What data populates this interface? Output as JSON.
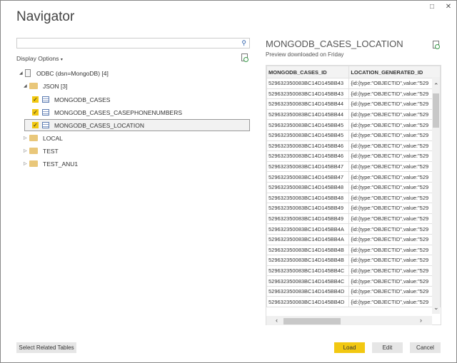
{
  "window": {
    "title": "Navigator",
    "restore_icon": "□",
    "close_icon": "✕"
  },
  "left": {
    "search_placeholder": "",
    "display_options": "Display Options",
    "dropdown_glyph": "▾",
    "tree": {
      "root": "ODBC (dsn=MongoDB) [4]",
      "json": "JSON [3]",
      "tables": [
        "MONGODB_CASES",
        "MONGODB_CASES_CASEPHONENUMBERS",
        "MONGODB_CASES_LOCATION"
      ],
      "folders": [
        "LOCAL",
        "TEST",
        "TEST_ANU1"
      ]
    }
  },
  "preview": {
    "title": "MONGODB_CASES_LOCATION",
    "subtitle": "Preview downloaded on Friday",
    "columns": [
      "MONGODB_CASES_ID",
      "LOCATION_GENERATED_ID"
    ],
    "rows": [
      [
        "529632350083BC14D145BB43",
        "{id:{type:\"OBJECTID\",value:\"529"
      ],
      [
        "529632350083BC14D145BB43",
        "{id:{type:\"OBJECTID\",value:\"529"
      ],
      [
        "529632350083BC14D145BB44",
        "{id:{type:\"OBJECTID\",value:\"529"
      ],
      [
        "529632350083BC14D145BB44",
        "{id:{type:\"OBJECTID\",value:\"529"
      ],
      [
        "529632350083BC14D145BB45",
        "{id:{type:\"OBJECTID\",value:\"529"
      ],
      [
        "529632350083BC14D145BB45",
        "{id:{type:\"OBJECTID\",value:\"529"
      ],
      [
        "529632350083BC14D145BB46",
        "{id:{type:\"OBJECTID\",value:\"529"
      ],
      [
        "529632350083BC14D145BB46",
        "{id:{type:\"OBJECTID\",value:\"529"
      ],
      [
        "529632350083BC14D145BB47",
        "{id:{type:\"OBJECTID\",value:\"529"
      ],
      [
        "529632350083BC14D145BB47",
        "{id:{type:\"OBJECTID\",value:\"529"
      ],
      [
        "529632350083BC14D145BB48",
        "{id:{type:\"OBJECTID\",value:\"529"
      ],
      [
        "529632350083BC14D145BB48",
        "{id:{type:\"OBJECTID\",value:\"529"
      ],
      [
        "529632350083BC14D145BB49",
        "{id:{type:\"OBJECTID\",value:\"529"
      ],
      [
        "529632350083BC14D145BB49",
        "{id:{type:\"OBJECTID\",value:\"529"
      ],
      [
        "529632350083BC14D145BB4A",
        "{id:{type:\"OBJECTID\",value:\"529"
      ],
      [
        "529632350083BC14D145BB4A",
        "{id:{type:\"OBJECTID\",value:\"529"
      ],
      [
        "529632350083BC14D145BB4B",
        "{id:{type:\"OBJECTID\",value:\"529"
      ],
      [
        "529632350083BC14D145BB4B",
        "{id:{type:\"OBJECTID\",value:\"529"
      ],
      [
        "529632350083BC14D145BB4C",
        "{id:{type:\"OBJECTID\",value:\"529"
      ],
      [
        "529632350083BC14D145BB4C",
        "{id:{type:\"OBJECTID\",value:\"529"
      ],
      [
        "529632350083BC14D145BB4D",
        "{id:{type:\"OBJECTID\",value:\"529"
      ],
      [
        "529632350083BC14D145BB4D",
        "{id:{type:\"OBJECTID\",value:\"529"
      ]
    ]
  },
  "buttons": {
    "select_related": "Select Related Tables",
    "load": "Load",
    "edit": "Edit",
    "cancel": "Cancel"
  },
  "colors": {
    "accent": "#f2c811"
  }
}
